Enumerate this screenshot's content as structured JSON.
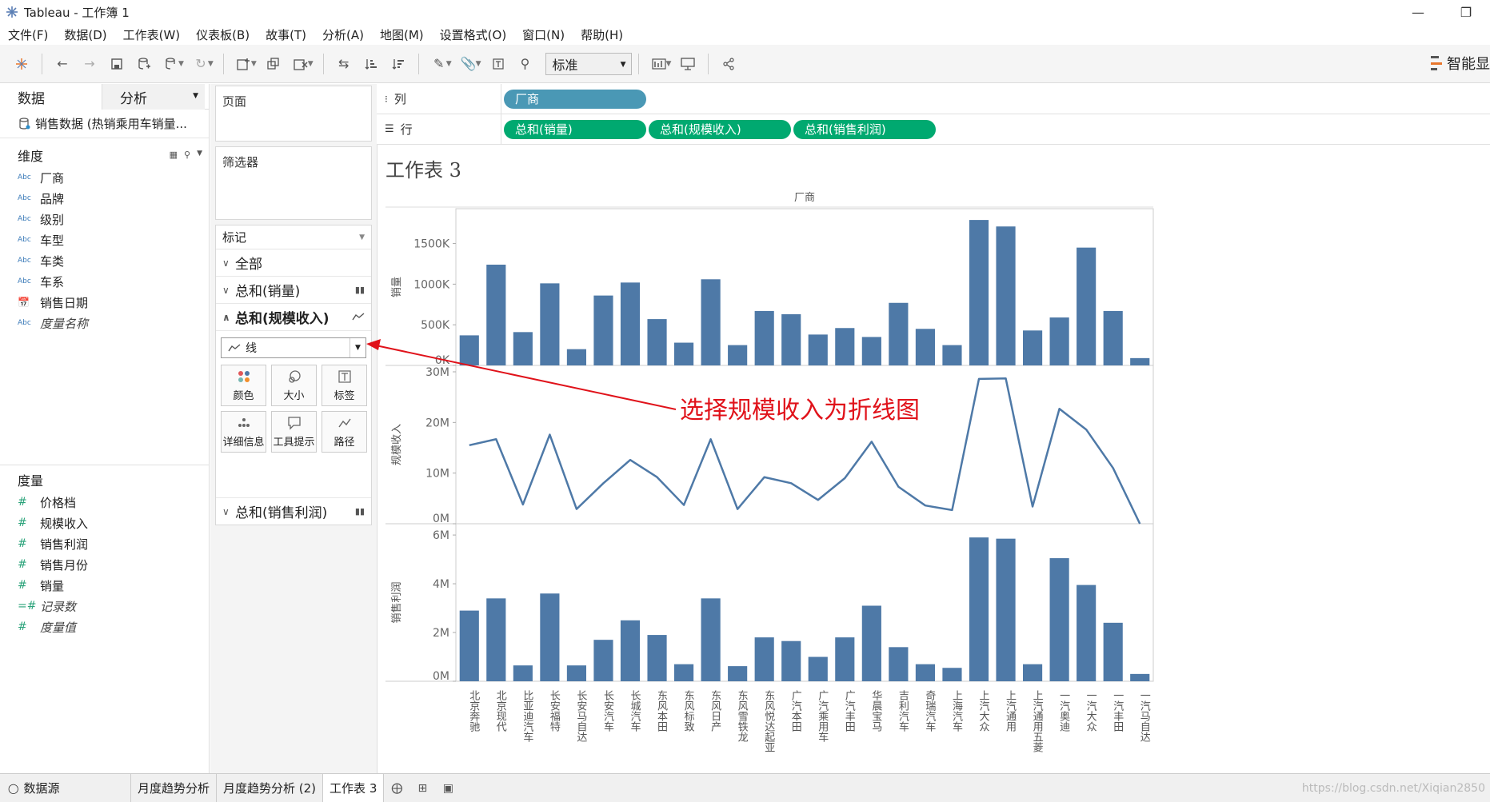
{
  "window": {
    "title": "Tableau - 工作簿 1",
    "min_label": "—",
    "restore_label": "❐"
  },
  "menu": [
    "文件(F)",
    "数据(D)",
    "工作表(W)",
    "仪表板(B)",
    "故事(T)",
    "分析(A)",
    "地图(M)",
    "设置格式(O)",
    "窗口(N)",
    "帮助(H)"
  ],
  "toolbar": {
    "fit_select": "标准",
    "smart_show": "智能显"
  },
  "left": {
    "tabs": [
      "数据",
      "分析"
    ],
    "datasource": "销售数据 (热销乘用车销量...",
    "dimensions_label": "维度",
    "dimensions": [
      {
        "type": "Abc",
        "name": "厂商"
      },
      {
        "type": "Abc",
        "name": "品牌"
      },
      {
        "type": "Abc",
        "name": "级别"
      },
      {
        "type": "Abc",
        "name": "车型"
      },
      {
        "type": "Abc",
        "name": "车类"
      },
      {
        "type": "Abc",
        "name": "车系"
      },
      {
        "type": "📅",
        "name": "销售日期"
      },
      {
        "type": "Abc",
        "name": "度量名称"
      }
    ],
    "measures_label": "度量",
    "measures": [
      {
        "type": "#",
        "name": "价格档"
      },
      {
        "type": "#",
        "name": "规模收入"
      },
      {
        "type": "#",
        "name": "销售利润"
      },
      {
        "type": "#",
        "name": "销售月份"
      },
      {
        "type": "#",
        "name": "销量"
      },
      {
        "type": "=#",
        "name": "记录数"
      },
      {
        "type": "#",
        "name": "度量值"
      }
    ]
  },
  "shelves": {
    "pages_label": "页面",
    "filters_label": "筛选器",
    "marks_label": "标记",
    "marks_rows": [
      "全部",
      "总和(销量)",
      "总和(规模收入)",
      "总和(销售利润)"
    ],
    "mark_type": "线",
    "mark_buttons": [
      "颜色",
      "大小",
      "标签",
      "详细信息",
      "工具提示",
      "路径"
    ],
    "columns_label": "列",
    "rows_label": "行",
    "column_pills": [
      "厂商"
    ],
    "row_pills": [
      "总和(销量)",
      "总和(规模收入)",
      "总和(销售利润)"
    ]
  },
  "view": {
    "sheet_title": "工作表 3",
    "annotation": "选择规模收入为折线图"
  },
  "chart_data": {
    "type": "bar",
    "header": "厂商",
    "categories": [
      "北京奔驰",
      "北京现代",
      "比亚迪汽车",
      "长安福特",
      "长安马自达",
      "长安汽车",
      "长城汽车",
      "东风本田",
      "东风标致",
      "东风日产",
      "东风雪铁龙",
      "东风悦达起亚",
      "广汽本田",
      "广汽乘用车",
      "广汽丰田",
      "华晨宝马",
      "吉利汽车",
      "奇瑞汽车",
      "上海汽车",
      "上汽大众",
      "上汽通用",
      "上汽通用五菱",
      "一汽奥迪",
      "一汽大众",
      "一汽丰田",
      "一汽马自达"
    ],
    "panes": [
      {
        "ylabel": "销量",
        "mark": "bar",
        "ylim": [
          0,
          1850000
        ],
        "ticks": [
          "0K",
          "500K",
          "1000K",
          "1500K"
        ],
        "tick_values": [
          0,
          500000,
          1000000,
          1500000
        ],
        "values": [
          370000,
          1240000,
          410000,
          1010000,
          200000,
          860000,
          1020000,
          570000,
          280000,
          1060000,
          250000,
          670000,
          630000,
          380000,
          460000,
          350000,
          770000,
          450000,
          250000,
          1790000,
          1710000,
          430000,
          590000,
          1450000,
          670000,
          90000
        ]
      },
      {
        "ylabel": "规模收入",
        "mark": "line",
        "ylim": [
          0,
          30000000
        ],
        "ticks": [
          "0M",
          "10M",
          "20M",
          "30M"
        ],
        "tick_values": [
          0,
          10000000,
          20000000,
          30000000
        ],
        "values": [
          15500000,
          16700000,
          3800000,
          17600000,
          2900000,
          8000000,
          12600000,
          9200000,
          3700000,
          16700000,
          2900000,
          9200000,
          8000000,
          4700000,
          9000000,
          16200000,
          7300000,
          3600000,
          2700000,
          28600000,
          28700000,
          3400000,
          22700000,
          18600000,
          11000000,
          0
        ]
      },
      {
        "ylabel": "销售利润",
        "mark": "bar",
        "ylim": [
          0,
          6200000
        ],
        "ticks": [
          "0M",
          "2M",
          "4M",
          "6M"
        ],
        "tick_values": [
          0,
          2000000,
          4000000,
          6000000
        ],
        "values": [
          2900000,
          3400000,
          650000,
          3600000,
          650000,
          1700000,
          2500000,
          1900000,
          700000,
          3400000,
          620000,
          1800000,
          1650000,
          1000000,
          1800000,
          3100000,
          1400000,
          700000,
          550000,
          5900000,
          5850000,
          700000,
          5050000,
          3950000,
          2400000,
          300000
        ]
      }
    ],
    "bar_color": "#4e79a7",
    "grid": false
  },
  "bottom_tabs": {
    "datasource_tab": "数据源",
    "sheets": [
      "月度趋势分析",
      "月度趋势分析 (2)",
      "工作表 3"
    ],
    "watermark": "https://blog.csdn.net/Xiqian2850"
  }
}
